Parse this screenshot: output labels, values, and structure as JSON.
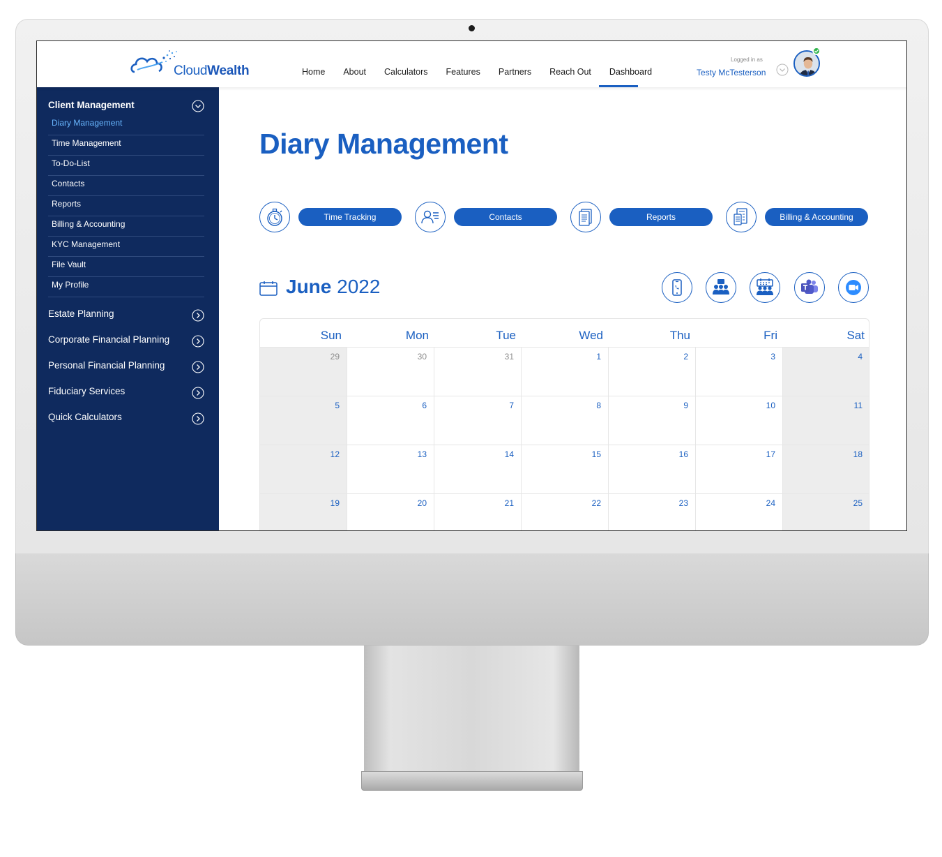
{
  "header": {
    "logo_text_light": "Cloud",
    "logo_text_bold": "Wealth",
    "nav": [
      "Home",
      "About",
      "Calculators",
      "Features",
      "Partners",
      "Reach Out",
      "Dashboard"
    ],
    "active_nav": "Dashboard",
    "logged_in_label": "Logged in as",
    "user_name": "Testy McTesterson",
    "status_color": "#2fb34a"
  },
  "sidebar": {
    "section_title": "Client Management",
    "sub_items": [
      "Diary Management",
      "Time Management",
      "To-Do-List",
      "Contacts",
      "Reports",
      "Billing & Accounting",
      "KYC Management",
      "File Vault",
      "My Profile"
    ],
    "active_sub_item": "Diary Management",
    "main_items": [
      "Estate Planning",
      "Corporate Financial Planning",
      "Personal Financial Planning",
      "Fiduciary Services",
      "Quick Calculators"
    ]
  },
  "main": {
    "page_title": "Diary Management",
    "quick_actions": [
      {
        "icon": "stopwatch-icon",
        "label": "Time Tracking"
      },
      {
        "icon": "contact-card-icon",
        "label": "Contacts"
      },
      {
        "icon": "report-document-icon",
        "label": "Reports"
      },
      {
        "icon": "invoice-icon",
        "label": "Billing & Accounting"
      }
    ],
    "month": "June",
    "year": "2022",
    "comm_icons": [
      "phone-call-icon",
      "group-chat-icon",
      "meeting-calendar-icon",
      "teams-icon",
      "zoom-video-icon"
    ],
    "calendar": {
      "weekdays": [
        "Sun",
        "Mon",
        "Tue",
        "Wed",
        "Thu",
        "Fri",
        "Sat"
      ],
      "weeks": [
        [
          "29",
          "30",
          "31",
          "1",
          "2",
          "3",
          "4"
        ],
        [
          "5",
          "6",
          "7",
          "8",
          "9",
          "10",
          "11"
        ],
        [
          "12",
          "13",
          "14",
          "15",
          "16",
          "17",
          "18"
        ],
        [
          "19",
          "20",
          "21",
          "22",
          "23",
          "24",
          "25"
        ]
      ],
      "other_month_days": [
        "29",
        "30",
        "31"
      ]
    }
  },
  "colors": {
    "brand_blue": "#1a5fc1",
    "sidebar_navy": "#0f2a5e",
    "active_sub_item": "#69b7ff",
    "weekend_fill": "#ededed"
  }
}
